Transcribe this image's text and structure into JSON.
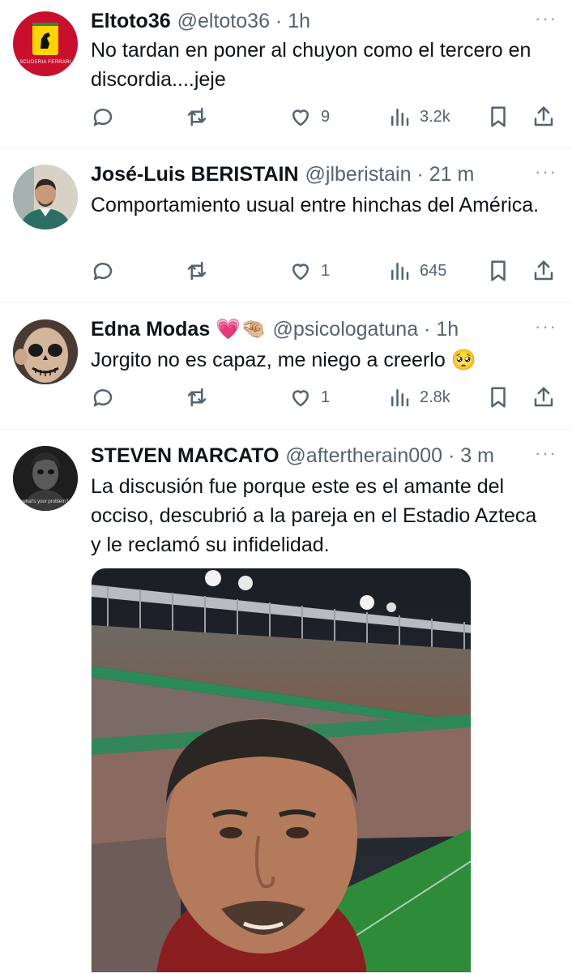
{
  "tweets": [
    {
      "name": "Eltoto36",
      "handle": "@eltoto36",
      "dot": "·",
      "time": "1h",
      "more": "···",
      "text": "No tardan en poner al chuyon como el tercero en discordia....jeje",
      "likes": "9",
      "views": "3.2k",
      "avatar_text": "SCUDERIA FERRARI",
      "avatar_colors": [
        "#c8102e",
        "#ffd400"
      ]
    },
    {
      "name": "José-Luis BERISTAIN",
      "handle": "@jlberistain",
      "dot": "·",
      "time": "21 m",
      "more": "···",
      "text": "Comportamiento usual entre hinchas del América.",
      "likes": "1",
      "views": "645"
    },
    {
      "name": "Edna Modas 💗🤏🏼",
      "handle": "@psicologatuna",
      "dot": "·",
      "time": "1h",
      "more": "···",
      "text": "Jorgito no es capaz, me niego a creerlo 🥺",
      "likes": "1",
      "views": "2.8k"
    },
    {
      "name": "STEVEN MARCATO",
      "handle": "@aftertherain000",
      "dot": "·",
      "time": "3 m",
      "more": "···",
      "text": "La discusión fue porque este es el amante del occiso, descubrió a la pareja en el Estadio Azteca y le reclamó su infidelidad.",
      "avatar_text": "what's your problem?"
    }
  ],
  "icons": [
    "reply-icon",
    "retweet-icon",
    "like-icon",
    "views-icon",
    "bookmark-icon",
    "share-icon"
  ],
  "colors": {
    "text": "#0f1419",
    "secondary": "#536471",
    "divider": "#eff3f4",
    "pitch": "#2e8b3a",
    "sky": "#1b1e25"
  }
}
